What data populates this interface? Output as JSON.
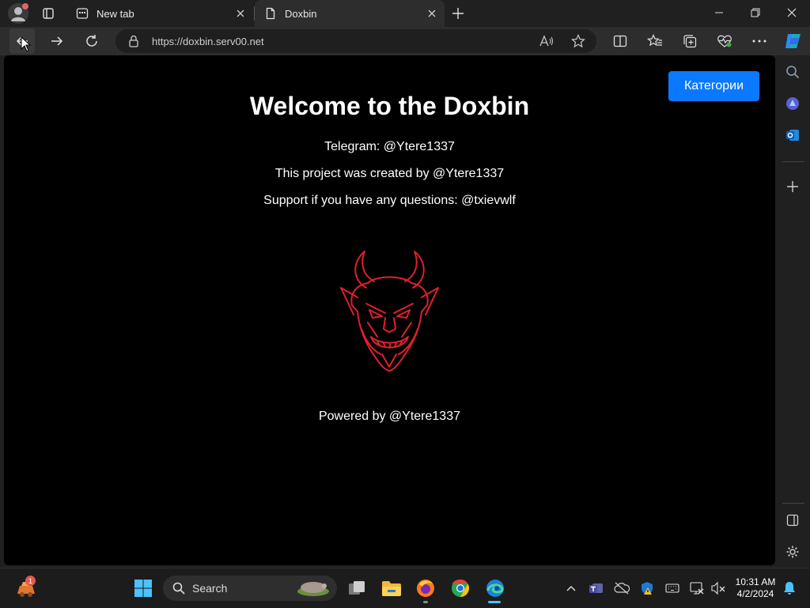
{
  "browser": {
    "tabs": [
      {
        "title": "New tab",
        "icon": "newtab-icon"
      },
      {
        "title": "Doxbin",
        "icon": "page-icon",
        "active": true
      }
    ],
    "address": {
      "url": "https://doxbin.serv00.net"
    }
  },
  "page": {
    "category_button": "Категории",
    "title": "Welcome to the Doxbin",
    "lines": [
      "Telegram: @Ytere1337",
      "This project was created by @Ytere1337",
      "Support if you have any questions: @txievwlf"
    ],
    "footer": "Powered by @Ytere1337",
    "accent_color": "#0b79ff",
    "logo_color": "#e0202c"
  },
  "taskbar": {
    "search_label": "Search",
    "notification_count": "1",
    "time": "10:31 AM",
    "date": "4/2/2024"
  }
}
